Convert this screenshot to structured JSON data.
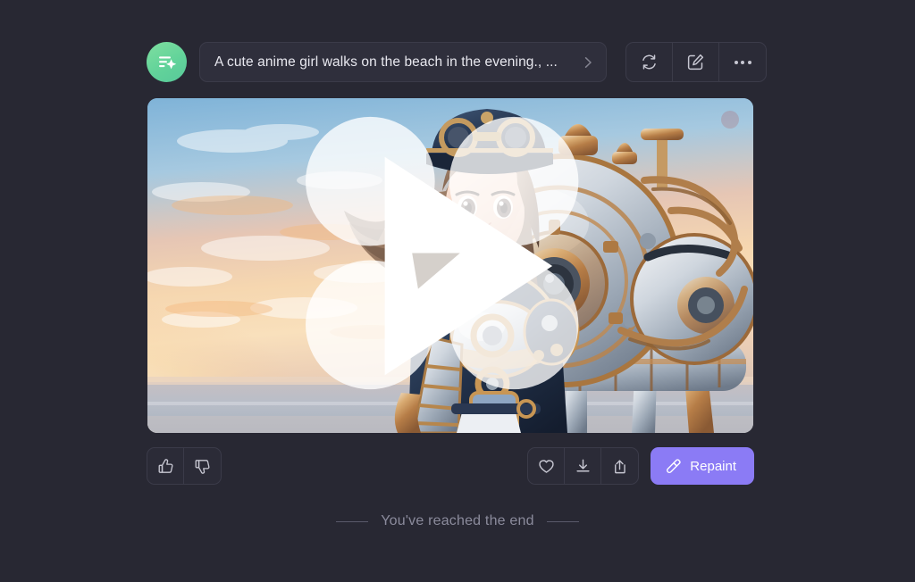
{
  "app": {
    "background_color": "#282833",
    "accent_color": "#8b7bf5",
    "avatar_color": "#62d39a"
  },
  "prompt": {
    "avatar_icon": "prompt-sparkle-icon",
    "text": "A cute anime girl walks on the beach in the evening., ...",
    "expand_icon": "chevron-right-icon"
  },
  "header_actions": [
    {
      "name": "regenerate-button",
      "icon": "refresh-icon",
      "label": ""
    },
    {
      "name": "edit-button",
      "icon": "edit-square-icon",
      "label": ""
    },
    {
      "name": "more-options-button",
      "icon": "ellipsis-icon",
      "label": ""
    }
  ],
  "media": {
    "type": "video",
    "play_icon": "play-icon",
    "watermark_icon": "four-circle-watermark-icon",
    "corner_mark_icon": "corner-stamp-icon",
    "description": "Steampunk anime girl in blue and gold armor with a peaked cap standing beside a large brass mechanical beast on a beach at sunset"
  },
  "feedback_actions": [
    {
      "name": "thumbs-up-button",
      "icon": "thumbs-up-icon"
    },
    {
      "name": "thumbs-down-button",
      "icon": "thumbs-down-icon"
    }
  ],
  "media_actions": [
    {
      "name": "favorite-button",
      "icon": "heart-icon"
    },
    {
      "name": "download-button",
      "icon": "download-icon"
    },
    {
      "name": "share-button",
      "icon": "share-icon"
    }
  ],
  "repaint": {
    "label": "Repaint",
    "icon": "brush-icon"
  },
  "end_marker": {
    "text": "You've reached the end"
  }
}
